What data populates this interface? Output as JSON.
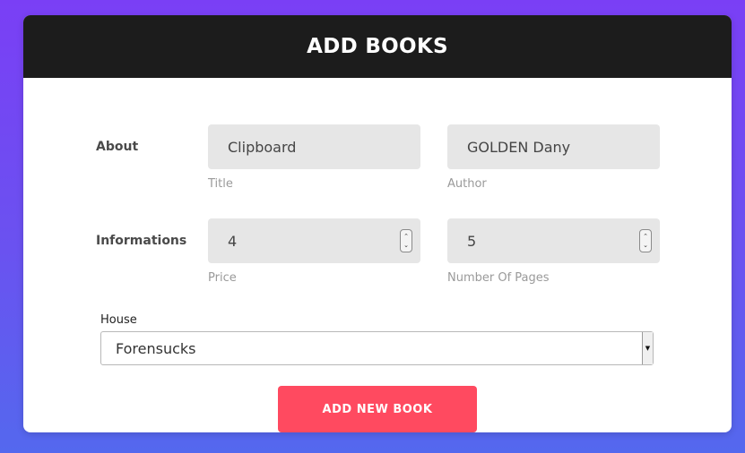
{
  "header": {
    "title": "ADD BOOKS"
  },
  "rows": {
    "about": {
      "label": "About",
      "title": {
        "value": "Clipboard",
        "help": "Title"
      },
      "author": {
        "value": "GOLDEN Dany",
        "help": "Author"
      }
    },
    "informations": {
      "label": "Informations",
      "price": {
        "value": "4",
        "help": "Price"
      },
      "pages": {
        "value": "5",
        "help": "Number Of Pages"
      }
    }
  },
  "house": {
    "label": "House",
    "selected": "Forensucks"
  },
  "submit": {
    "label": "ADD NEW BOOK"
  },
  "icons": {
    "spinner": "number-spinner-icon",
    "select_arrow": "dropdown-arrow-icon"
  },
  "colors": {
    "header_bg": "#1c1c1c",
    "button_bg": "#ff4a60",
    "field_bg": "#e6e6e6"
  }
}
